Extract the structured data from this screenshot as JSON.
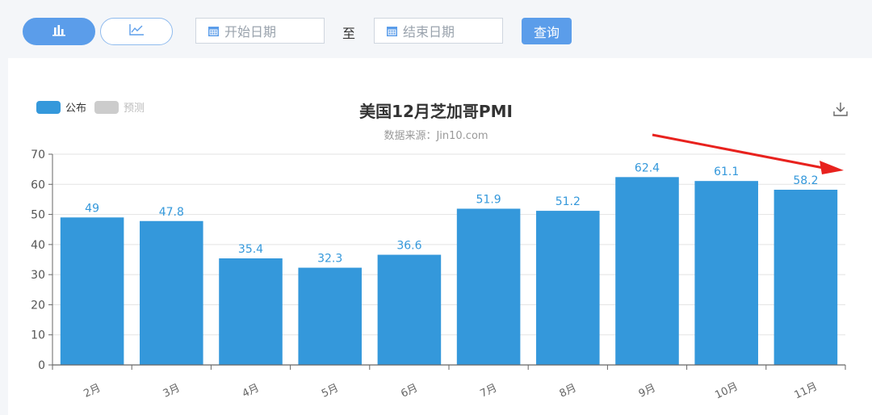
{
  "toolbar": {
    "start_placeholder": "开始日期",
    "to_label": "至",
    "end_placeholder": "结束日期",
    "query_label": "查询",
    "accent": "#5b9dea"
  },
  "legend": [
    {
      "label": "公布",
      "color": "#3498db"
    },
    {
      "label": "预测",
      "color": "#cccccc"
    }
  ],
  "chart_data": {
    "type": "bar",
    "title": "美国12月芝加哥PMI",
    "subtitle": "数据来源：Jin10.com",
    "categories": [
      "2月",
      "3月",
      "4月",
      "5月",
      "6月",
      "7月",
      "8月",
      "9月",
      "10月",
      "11月"
    ],
    "series": [
      {
        "name": "公布",
        "values": [
          49,
          47.8,
          35.4,
          32.3,
          36.6,
          51.9,
          51.2,
          62.4,
          61.1,
          58.2
        ]
      }
    ],
    "ylim": [
      0,
      70
    ],
    "yticks": [
      0,
      10,
      20,
      30,
      40,
      50,
      60,
      70
    ],
    "grid": true,
    "legend_position": "top-left",
    "bar_color": "#3498db",
    "label_color": "#3498db",
    "annotation": "red arrow pointing up-right toward end of chart"
  }
}
